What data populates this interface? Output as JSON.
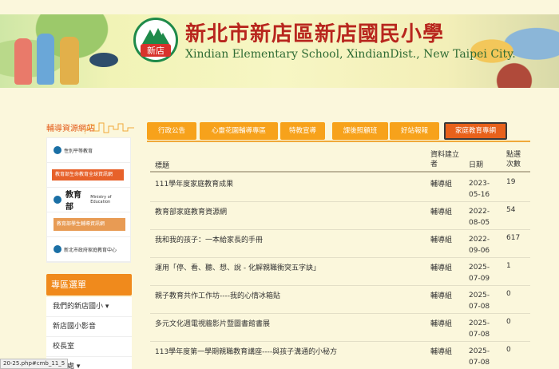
{
  "header": {
    "logo_text": "新店",
    "title": "新北市新店區新店國民小學",
    "subtitle": "Xindian Elementary School, XindianDist., New Taipei City."
  },
  "sidebar": {
    "links_title": "輔導資源網站",
    "links": [
      {
        "label": "性別平等教育"
      },
      {
        "label": "教育部生命教育全球資訊網"
      },
      {
        "label": "教育部",
        "sub": "Ministry of Education"
      },
      {
        "label": "教育部學生輔導資訊網"
      },
      {
        "label": "新北市政府家庭教育中心"
      }
    ],
    "zone_title": "專區選單",
    "zone_items": [
      {
        "label": "我們的新店國小 ▾"
      },
      {
        "label": "新店國小影音"
      },
      {
        "label": "校長室"
      },
      {
        "label": "教務處 ▾"
      }
    ]
  },
  "tabs": [
    {
      "label": "行政公告"
    },
    {
      "label": "心靈花園輔導專區"
    },
    {
      "label": "特教宣導"
    },
    {
      "label": "課後照顧班"
    },
    {
      "label": "好站報報"
    },
    {
      "label": "家庭教育專網"
    }
  ],
  "table": {
    "headers": {
      "title": "標題",
      "creator": "資料建立者",
      "date": "日期",
      "views": "點選次數"
    },
    "rows": [
      {
        "title": "111學年度家庭教育成果",
        "creator": "輔導組",
        "date": "2023-05-16",
        "views": "19"
      },
      {
        "title": "教育部家庭教育資源網",
        "creator": "輔導組",
        "date": "2022-08-05",
        "views": "54"
      },
      {
        "title": "我和我的孩子：一本給家長的手冊",
        "creator": "輔導組",
        "date": "2022-09-06",
        "views": "617"
      },
      {
        "title": "運用「停、看、聽、想、說 - 化解親職衝突五字訣」",
        "creator": "輔導組",
        "date": "2025-07-09",
        "views": "1"
      },
      {
        "title": "親子教育共作工作坊----我的心情冰箱貼",
        "creator": "輔導組",
        "date": "2025-07-08",
        "views": "0"
      },
      {
        "title": "多元文化週電視牆影片暨圖書館書展",
        "creator": "輔導組",
        "date": "2025-07-08",
        "views": "0"
      },
      {
        "title": "113學年度第一學期親職教育講座----與孩子溝通的小秘方",
        "creator": "輔導組",
        "date": "2025-07-08",
        "views": "0"
      }
    ]
  },
  "status_bar": "20-25.php#cmb_11_5"
}
